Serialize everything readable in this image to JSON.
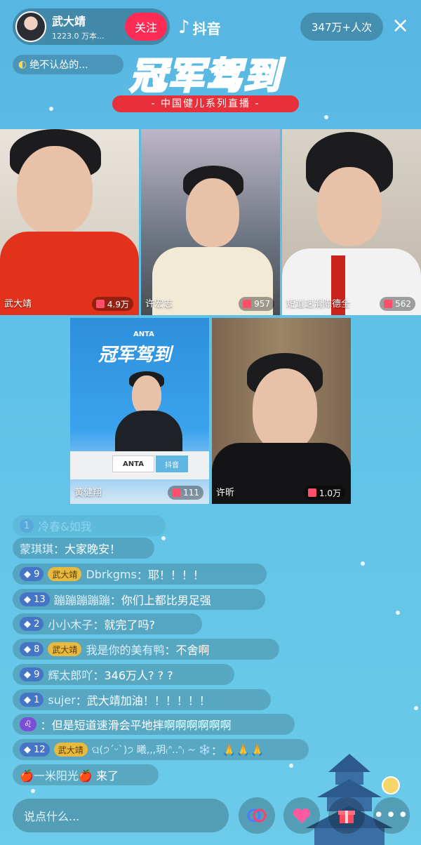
{
  "header": {
    "host_name": "武大靖",
    "host_followers": "1223.0 万本...",
    "follow_label": "关注",
    "app_name": "抖音",
    "viewers": "347万+人次",
    "close_icon": "×",
    "task_text": "绝不认怂的..."
  },
  "banner": {
    "title": "冠军驾到",
    "subtitle": "- 中国健儿系列直播 -"
  },
  "tiles": [
    {
      "name": "武大靖",
      "gifts": "4.9万"
    },
    {
      "name": "许宏志",
      "gifts": "957"
    },
    {
      "name": "短道速滑陈德全",
      "gifts": "562"
    },
    {
      "name": "黄健翔",
      "gifts": "111"
    },
    {
      "name": "许昕",
      "gifts": "1.0万"
    }
  ],
  "studio": {
    "brand": "ANTA",
    "backdrop_title": "冠军驾到",
    "desk_app": "抖音"
  },
  "chat": [
    {
      "level": "1",
      "user": "冷春&如我",
      "msg": ""
    },
    {
      "level": "",
      "user": "蒙琪琪",
      "msg": "大家晚安！"
    },
    {
      "level": "9",
      "badge": "武大靖",
      "user": "Dbrkgms",
      "msg": "耶！！！！"
    },
    {
      "level": "13",
      "user": "蹦蹦蹦蹦蹦",
      "msg": "你们上都比男足强"
    },
    {
      "level": "2",
      "user": "小小木子",
      "msg": "就完了吗?"
    },
    {
      "level": "8",
      "badge": "武大靖",
      "user": "我是你的美有鸭",
      "msg": "不舍啊"
    },
    {
      "level": "9",
      "user": "辉太郎吖",
      "msg": "346万人? ? ?"
    },
    {
      "level": "1",
      "user": "sujer",
      "msg": "武大靖加油！！！！！！"
    },
    {
      "level": "♌",
      "user": "",
      "msg": "但是短道速滑会平地摔啊啊啊啊啊啊"
    },
    {
      "level": "12",
      "badge": "武大靖",
      "user": "ଘ(੭ˊᵕˋ)੭ 曦,,,玥₍ᐢ..ᐢ₎ ~ ❄️",
      "msg": "🙏🙏🙏"
    },
    {
      "level": "",
      "user": "🍎一米阳光🍎",
      "msg": "来了"
    }
  ],
  "bottom": {
    "input_placeholder": "说点什么...",
    "buttons": [
      "link-icon",
      "heart-icon",
      "gift-icon",
      "more-icon"
    ]
  },
  "colors": {
    "accent": "#fe2c55",
    "background": "#5fc0e6",
    "banner_red": "#e8303a",
    "banner_blue": "#1aa2f0"
  }
}
